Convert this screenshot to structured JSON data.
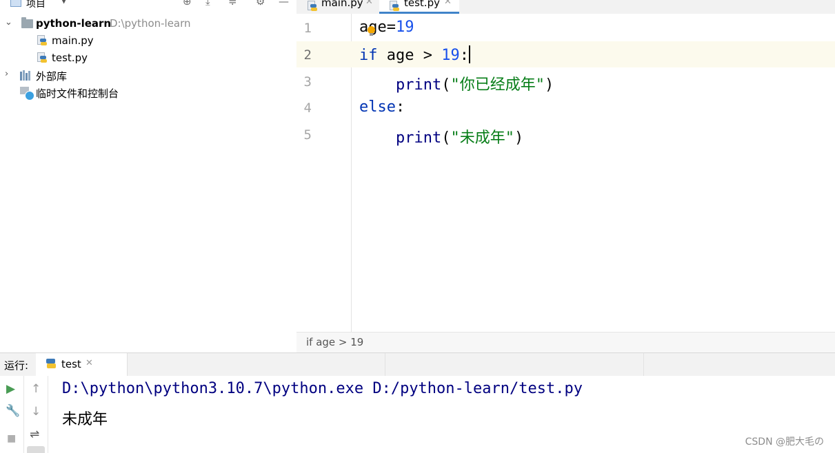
{
  "project_panel": {
    "title": "项目",
    "dropdown_glyph": "▼",
    "toolbar_icons": [
      "target-icon",
      "collapse-all-icon",
      "expand-all-icon",
      "gear-icon",
      "minimize-icon"
    ],
    "tree": {
      "root_name": "python-learn",
      "root_path": "D:\\python-learn",
      "files": [
        "main.py",
        "test.py"
      ],
      "external_libs": "外部库",
      "scratches": "临时文件和控制台"
    }
  },
  "editor": {
    "tabs": [
      {
        "label": "main.py",
        "active": false
      },
      {
        "label": "test.py",
        "active": true
      }
    ],
    "line_numbers": [
      "1",
      "2",
      "3",
      "4",
      "5"
    ],
    "code": {
      "l1_var": "age",
      "l1_op": "=",
      "l1_num": "19",
      "l2_kw": "if",
      "l2_mid": " age > ",
      "l2_num": "19",
      "l2_colon": ":",
      "l3_indent": "    ",
      "l3_fn": "print",
      "l3_open": "(",
      "l3_str": "\"你已经成年\"",
      "l3_close": ")",
      "l4_kw": "else",
      "l4_colon": ":",
      "l5_indent": "    ",
      "l5_fn": "print",
      "l5_open": "(",
      "l5_str": "\"未成年\"",
      "l5_close": ")"
    },
    "current_line": 2,
    "breadcrumb": "if age > 19"
  },
  "run_panel": {
    "title": "运行:",
    "tab_label": "test",
    "console": {
      "command": "D:\\python\\python3.10.7\\python.exe D:/python-learn/test.py",
      "output": "未成年"
    }
  },
  "watermark": "CSDN @肥大毛の",
  "colors": {
    "keyword": "#0033b3",
    "number": "#1750eb",
    "string": "#067d17",
    "function": "#000080",
    "tab_underline": "#4083c9",
    "current_line_bg": "#fcfaed"
  }
}
